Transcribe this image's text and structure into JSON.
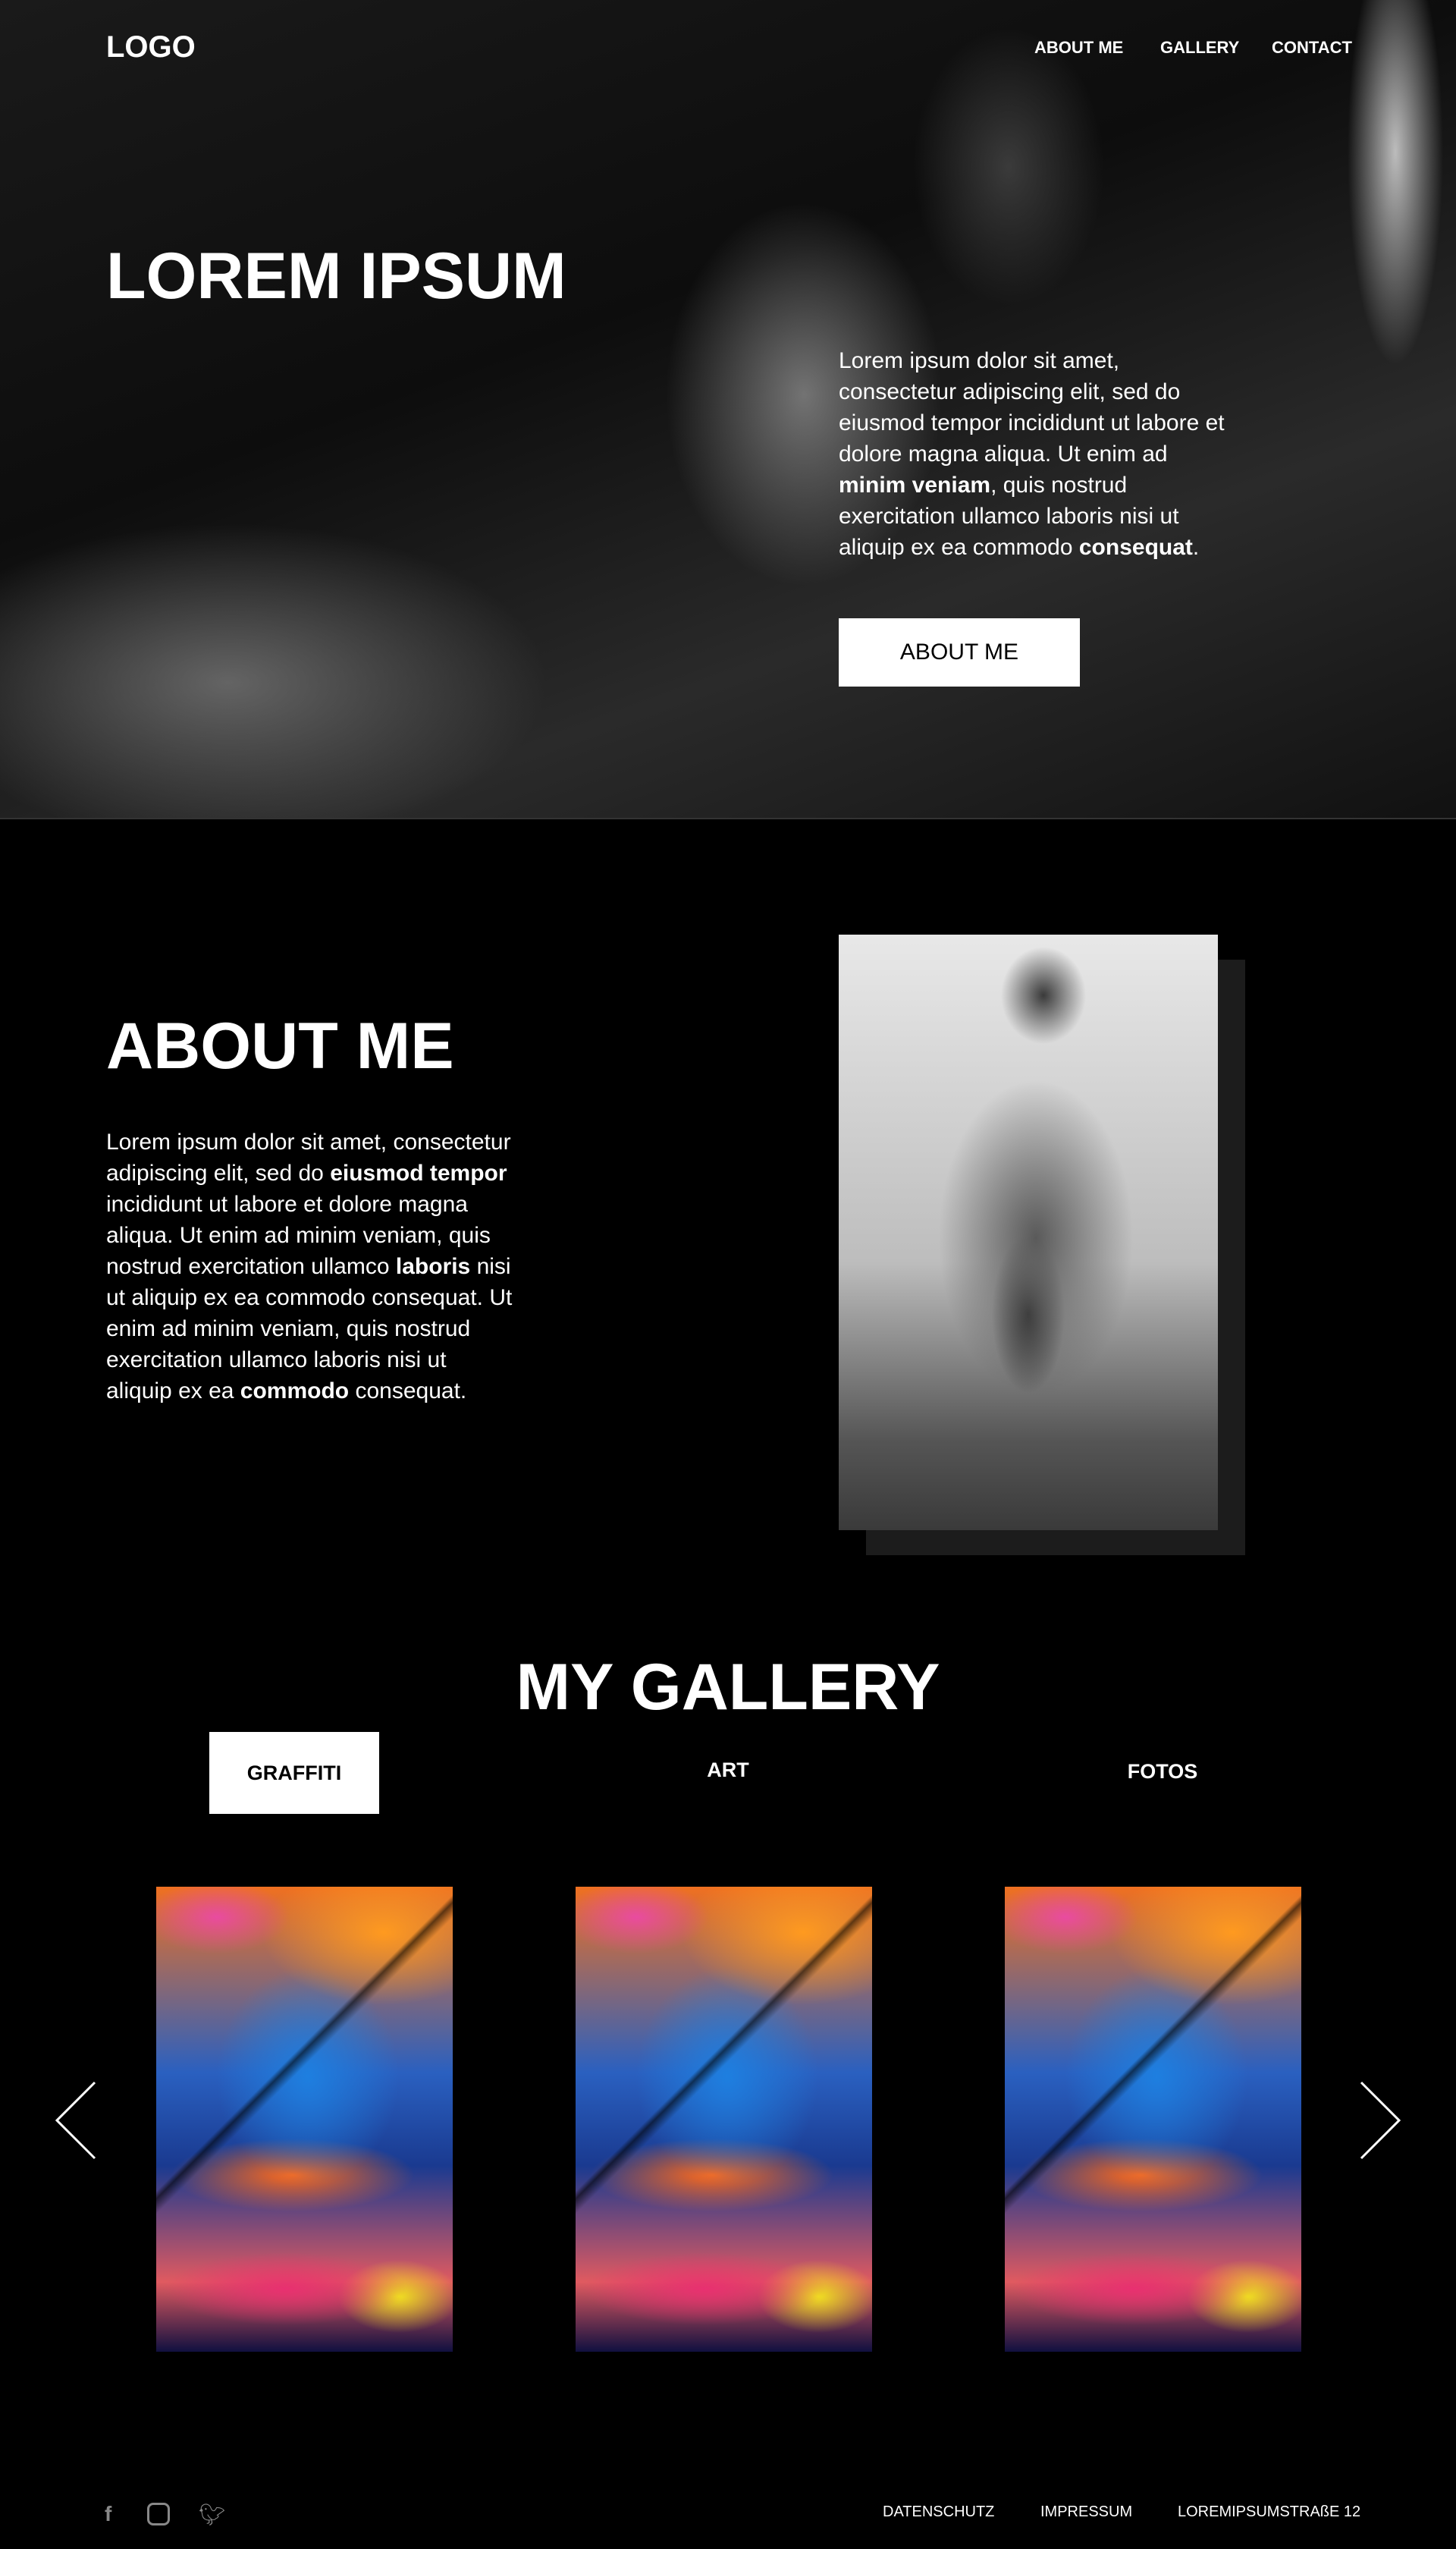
{
  "header": {
    "logo": "LOGO",
    "nav": [
      "ABOUT ME",
      "GALLERY",
      "CONTACT"
    ]
  },
  "hero": {
    "title": "LOREM IPSUM",
    "text": [
      "Lorem ipsum dolor sit amet, consectetur adipiscing elit, sed do eiusmod tempor incididunt ut labore et dolore magna aliqua. Ut enim ad ",
      "minim veniam",
      ", quis nostrud exercitation ullamco laboris nisi ut aliquip ex ea commodo ",
      "consequat",
      "."
    ],
    "button": "ABOUT ME"
  },
  "about": {
    "title": "ABOUT ME",
    "text": [
      "Lorem ipsum dolor sit amet, consectetur adipiscing elit, sed do ",
      "eiusmod tempor",
      " incididunt ut labore et dolore magna aliqua. Ut enim ad minim veniam, quis nostrud exercitation ullamco ",
      "laboris",
      " nisi ut aliquip ex ea commodo consequat. Ut enim ad minim veniam, quis nostrud exercitation ullamco laboris nisi ut aliquip ex ea ",
      "commodo",
      " consequat."
    ]
  },
  "gallery": {
    "title": "MY GALLERY",
    "tabs": [
      "GRAFFITI",
      "ART",
      "FOTOS"
    ],
    "active_tab": "GRAFFITI"
  },
  "footer": {
    "social_icons": [
      "facebook-icon",
      "instagram-icon",
      "twitter-icon"
    ],
    "links": [
      "DATENSCHUTZ",
      "IMPRESSUM",
      "LOREMIPSUMSTRAßE 12"
    ]
  }
}
